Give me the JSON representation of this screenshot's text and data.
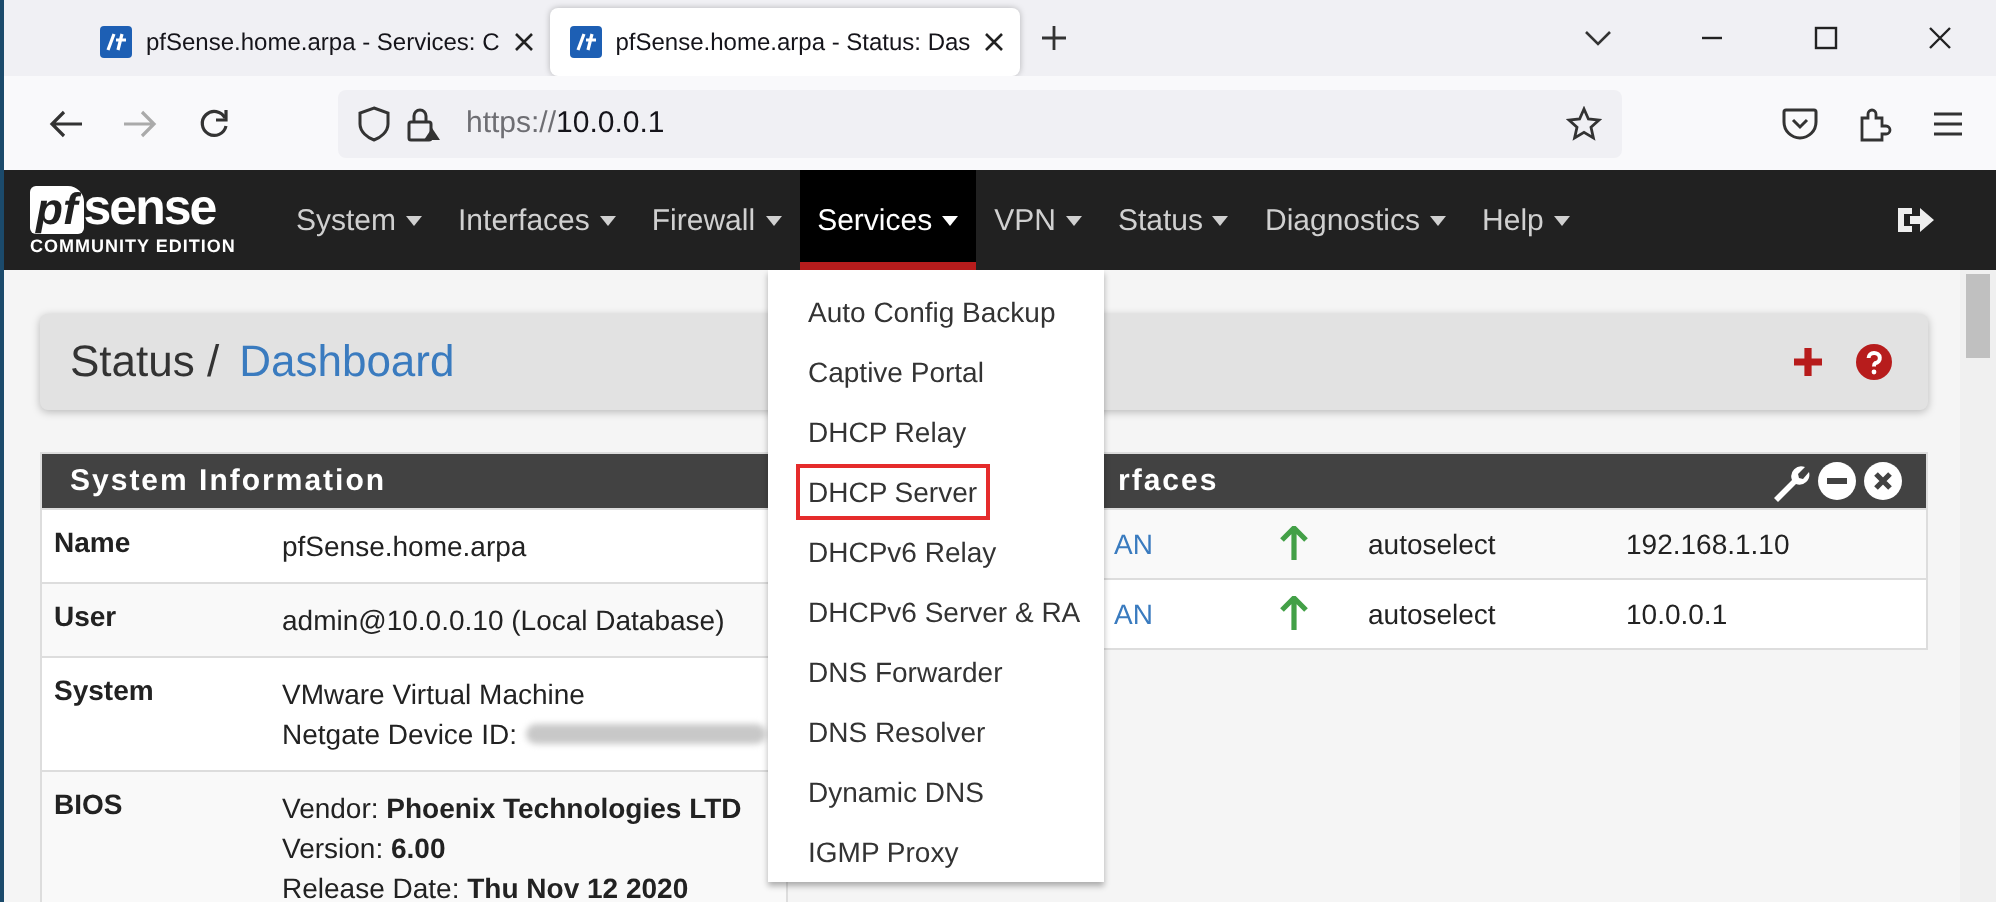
{
  "browser": {
    "tabs": [
      {
        "title": "pfSense.home.arpa - Services: C",
        "selected": false
      },
      {
        "title": "pfSense.home.arpa - Status: Das",
        "selected": true
      }
    ],
    "address": {
      "scheme": "https://",
      "host": "10.0.0.1"
    }
  },
  "navbar": {
    "logo": {
      "mark": "pf",
      "word": "sense",
      "subtitle": "COMMUNITY EDITION"
    },
    "menu": [
      {
        "label": "System",
        "selected": false
      },
      {
        "label": "Interfaces",
        "selected": false
      },
      {
        "label": "Firewall",
        "selected": false
      },
      {
        "label": "Services",
        "selected": true
      },
      {
        "label": "VPN",
        "selected": false
      },
      {
        "label": "Status",
        "selected": false
      },
      {
        "label": "Diagnostics",
        "selected": false
      },
      {
        "label": "Help",
        "selected": false
      }
    ]
  },
  "breadcrumb": {
    "section": "Status /",
    "page": "Dashboard"
  },
  "system_information": {
    "title": "System Information",
    "rows": [
      {
        "label": "Name",
        "lines": [
          "pfSense.home.arpa"
        ]
      },
      {
        "label": "User",
        "lines": [
          "admin@10.0.0.10 (Local Database)"
        ]
      },
      {
        "label": "System",
        "lines": [
          "VMware Virtual Machine",
          "Netgate Device ID:"
        ],
        "redacted": true
      },
      {
        "label": "BIOS",
        "lines": [
          "Vendor: **Phoenix Technologies LTD**",
          "Version: **6.00**",
          "Release Date: **Thu Nov 12 2020**"
        ]
      }
    ]
  },
  "interfaces": {
    "title": "rfaces",
    "rows": [
      {
        "name": "AN",
        "up": true,
        "media": "autoselect",
        "address": "192.168.1.10"
      },
      {
        "name": "AN",
        "up": true,
        "media": "autoselect",
        "address": "10.0.0.1"
      }
    ]
  },
  "services_menu": {
    "items": [
      {
        "label": "Auto Config Backup",
        "highlighted": false
      },
      {
        "label": "Captive Portal",
        "highlighted": false
      },
      {
        "label": "DHCP Relay",
        "highlighted": false
      },
      {
        "label": "DHCP Server",
        "highlighted": true
      },
      {
        "label": "DHCPv6 Relay",
        "highlighted": false
      },
      {
        "label": "DHCPv6 Server & RA",
        "highlighted": false
      },
      {
        "label": "DNS Forwarder",
        "highlighted": false
      },
      {
        "label": "DNS Resolver",
        "highlighted": false
      },
      {
        "label": "Dynamic DNS",
        "highlighted": false
      },
      {
        "label": "IGMP Proxy",
        "highlighted": false
      }
    ]
  }
}
